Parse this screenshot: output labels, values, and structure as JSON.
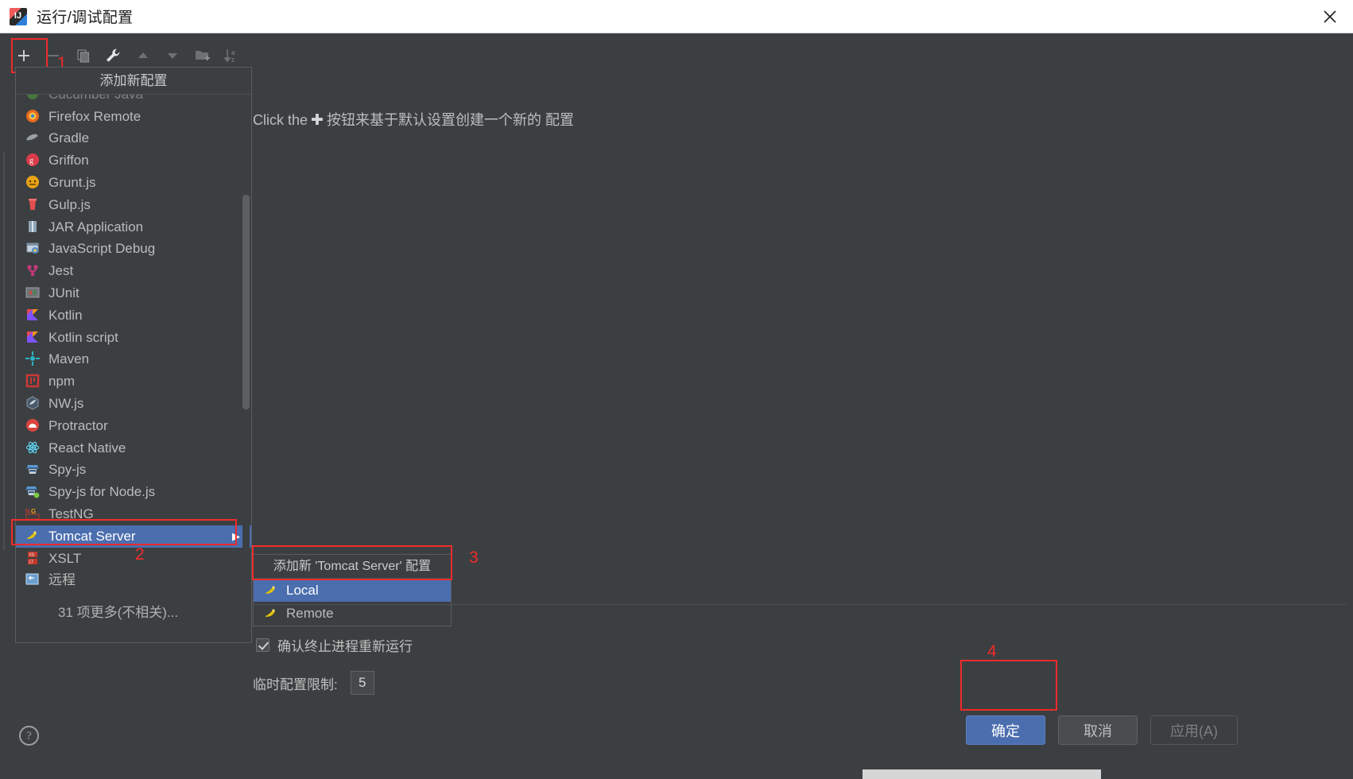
{
  "window": {
    "title": "运行/调试配置",
    "app_icon": "intellij-idea-icon",
    "close_label": "✕"
  },
  "toolbar": {
    "buttons": [
      {
        "name": "add-configuration-button",
        "icon": "plus-icon",
        "enabled": true
      },
      {
        "name": "remove-configuration-button",
        "icon": "minus-icon",
        "enabled": false
      },
      {
        "name": "copy-configuration-button",
        "icon": "copy-icon",
        "enabled": false
      },
      {
        "name": "edit-templates-button",
        "icon": "wrench-icon",
        "enabled": true
      },
      {
        "name": "move-up-button",
        "icon": "arrow-up-icon",
        "enabled": false
      },
      {
        "name": "move-down-button",
        "icon": "arrow-down-icon",
        "enabled": false
      },
      {
        "name": "new-folder-button",
        "icon": "folder-add-icon",
        "enabled": false
      },
      {
        "name": "sort-button",
        "icon": "sort-az-icon",
        "enabled": false
      }
    ]
  },
  "add_popup": {
    "header": "添加新配置",
    "items": [
      {
        "label": "Cucumber Java",
        "icon": "cucumber-icon",
        "icon_color": "#4fa637",
        "glyph": "",
        "partial": true
      },
      {
        "label": "Firefox Remote",
        "icon": "firefox-icon",
        "icon_color": "#e86a21",
        "glyph": ""
      },
      {
        "label": "Gradle",
        "icon": "gradle-icon",
        "icon_color": "#9aa0a6",
        "glyph": ""
      },
      {
        "label": "Griffon",
        "icon": "griffon-icon",
        "icon_color": "#d93b4a",
        "glyph": "g"
      },
      {
        "label": "Grunt.js",
        "icon": "grunt-icon",
        "icon_color": "#e8a317",
        "glyph": ""
      },
      {
        "label": "Gulp.js",
        "icon": "gulp-icon",
        "icon_color": "#e34f4f",
        "glyph": ""
      },
      {
        "label": "JAR Application",
        "icon": "jar-icon",
        "icon_color": "#8fa4b8",
        "glyph": ""
      },
      {
        "label": "JavaScript Debug",
        "icon": "js-debug-icon",
        "icon_color": "#5b8fc9",
        "glyph": ""
      },
      {
        "label": "Jest",
        "icon": "jest-icon",
        "icon_color": "#c6397a",
        "glyph": ""
      },
      {
        "label": "JUnit",
        "icon": "junit-icon",
        "icon_color": "#3d8b40",
        "glyph": ""
      },
      {
        "label": "Kotlin",
        "icon": "kotlin-icon",
        "icon_color": "#7f52ff",
        "glyph": ""
      },
      {
        "label": "Kotlin script",
        "icon": "kotlin-icon",
        "icon_color": "#7f52ff",
        "glyph": ""
      },
      {
        "label": "Maven",
        "icon": "maven-icon",
        "icon_color": "#2cb3c6",
        "glyph": ""
      },
      {
        "label": "npm",
        "icon": "npm-icon",
        "icon_color": "#cb3837",
        "glyph": ""
      },
      {
        "label": "NW.js",
        "icon": "nwjs-icon",
        "icon_color": "#4a5a6a",
        "glyph": ""
      },
      {
        "label": "Protractor",
        "icon": "protractor-icon",
        "icon_color": "#d9443f",
        "glyph": ""
      },
      {
        "label": "React Native",
        "icon": "react-icon",
        "icon_color": "#61dafb",
        "glyph": ""
      },
      {
        "label": "Spy-js",
        "icon": "spyjs-icon",
        "icon_color": "#5b9ad6",
        "glyph": ""
      },
      {
        "label": "Spy-js for Node.js",
        "icon": "spyjs-node-icon",
        "icon_color": "#5b9ad6",
        "glyph": ""
      },
      {
        "label": "TestNG",
        "icon": "testng-icon",
        "icon_color": "#b5392f",
        "glyph": ""
      },
      {
        "label": "Tomcat Server",
        "icon": "tomcat-icon",
        "icon_color": "#e3c20a",
        "glyph": "",
        "selected": true,
        "has_submenu": true,
        "submenu_arrow": "▶"
      },
      {
        "label": "XSLT",
        "icon": "xslt-icon",
        "icon_color": "#c0392b",
        "glyph": ""
      },
      {
        "label": "远程",
        "icon": "remote-icon",
        "icon_color": "#5b9ad6",
        "glyph": ""
      }
    ],
    "more_label": "31 项更多(不相关)..."
  },
  "submenu": {
    "header": "添加新 'Tomcat Server' 配置",
    "items": [
      {
        "label": "Local",
        "icon": "tomcat-icon",
        "selected": true
      },
      {
        "label": "Remote",
        "icon": "tomcat-icon",
        "selected": false
      }
    ]
  },
  "main": {
    "hint_prefix": "Click the",
    "hint_plus": "✚",
    "hint_suffix": "按钮来基于默认设置创建一个新的 配置",
    "confirm_checkbox": {
      "label": "确认终止进程重新运行",
      "checked": true
    },
    "temp_limit": {
      "label": "临时配置限制:",
      "value": "5"
    }
  },
  "footer": {
    "help_glyph": "?",
    "ok_label": "确定",
    "cancel_label": "取消",
    "apply_label": "应用(A)"
  },
  "annotations": [
    {
      "number": "1",
      "target": "add-configuration-button"
    },
    {
      "number": "2",
      "target": "tomcat-server-list-item"
    },
    {
      "number": "3",
      "target": "submenu-local-item"
    },
    {
      "number": "4",
      "target": "ok-button"
    }
  ],
  "colors": {
    "dialog_bg": "#3c3f41",
    "selection_blue": "#4b6eaf",
    "annotation_red": "#ef2b2b",
    "text_primary": "#bbbbbb",
    "titlebar_bg": "#ffffff"
  }
}
